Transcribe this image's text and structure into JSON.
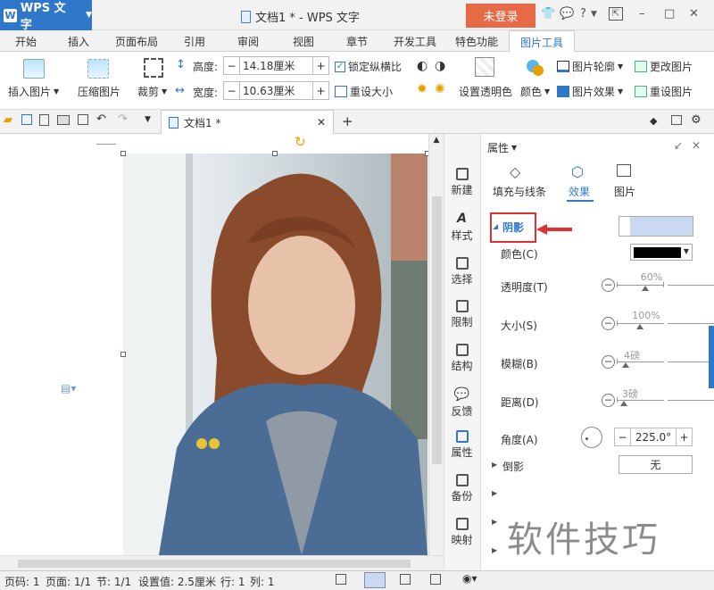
{
  "titlebar": {
    "app_name": "WPS 文字",
    "doc_title": "文档1 * - WPS 文字",
    "login": "未登录",
    "help": "?",
    "minimize": "–",
    "maximize": "□",
    "close": "✕"
  },
  "tabs": [
    "开始",
    "插入",
    "页面布局",
    "引用",
    "审阅",
    "视图",
    "章节",
    "开发工具",
    "特色功能",
    "图片工具"
  ],
  "ribbon": {
    "insert_picture": "插入图片",
    "compress_picture": "压缩图片",
    "crop": "裁剪",
    "height_label": "高度:",
    "height_value": "14.18厘米",
    "width_label": "宽度:",
    "width_value": "10.63厘米",
    "lock_ratio": "锁定纵横比",
    "reset_size": "重设大小",
    "set_transparent": "设置透明色",
    "color": "颜色",
    "picture_outline": "图片轮廓",
    "picture_effect": "图片效果",
    "change_picture": "更改图片",
    "reset_picture": "重设图片",
    "minus": "−",
    "plus": "+"
  },
  "doc_tab": {
    "label": "文档1 *",
    "close": "✕",
    "new": "+"
  },
  "sidebar": [
    "新建",
    "样式",
    "选择",
    "限制",
    "结构",
    "反馈",
    "属性",
    "备份",
    "映射"
  ],
  "panel": {
    "title": "属性",
    "tabs": [
      "填充与线条",
      "效果",
      "图片"
    ],
    "shadow_label": "阴影",
    "color_label": "颜色(C)",
    "transparency_label": "透明度(T)",
    "transparency_value": "60%",
    "size_label": "大小(S)",
    "size_value": "100%",
    "blur_label": "模糊(B)",
    "blur_value": "4磅",
    "distance_label": "距离(D)",
    "distance_value": "3磅",
    "angle_label": "角度(A)",
    "angle_value": "225.0°",
    "reflection_label": "倒影",
    "reflection_value": "无"
  },
  "status": {
    "page_num": "页码: 1",
    "pages": "页面: 1/1",
    "section": "节: 1/1",
    "setting": "设置值: 2.5厘米",
    "row": "行: 1",
    "col": "列: 1"
  },
  "watermark": "软件技巧",
  "colors": {
    "accent": "#2e77c9",
    "login_bg": "#e66a45",
    "highlight_box": "#e03030"
  }
}
